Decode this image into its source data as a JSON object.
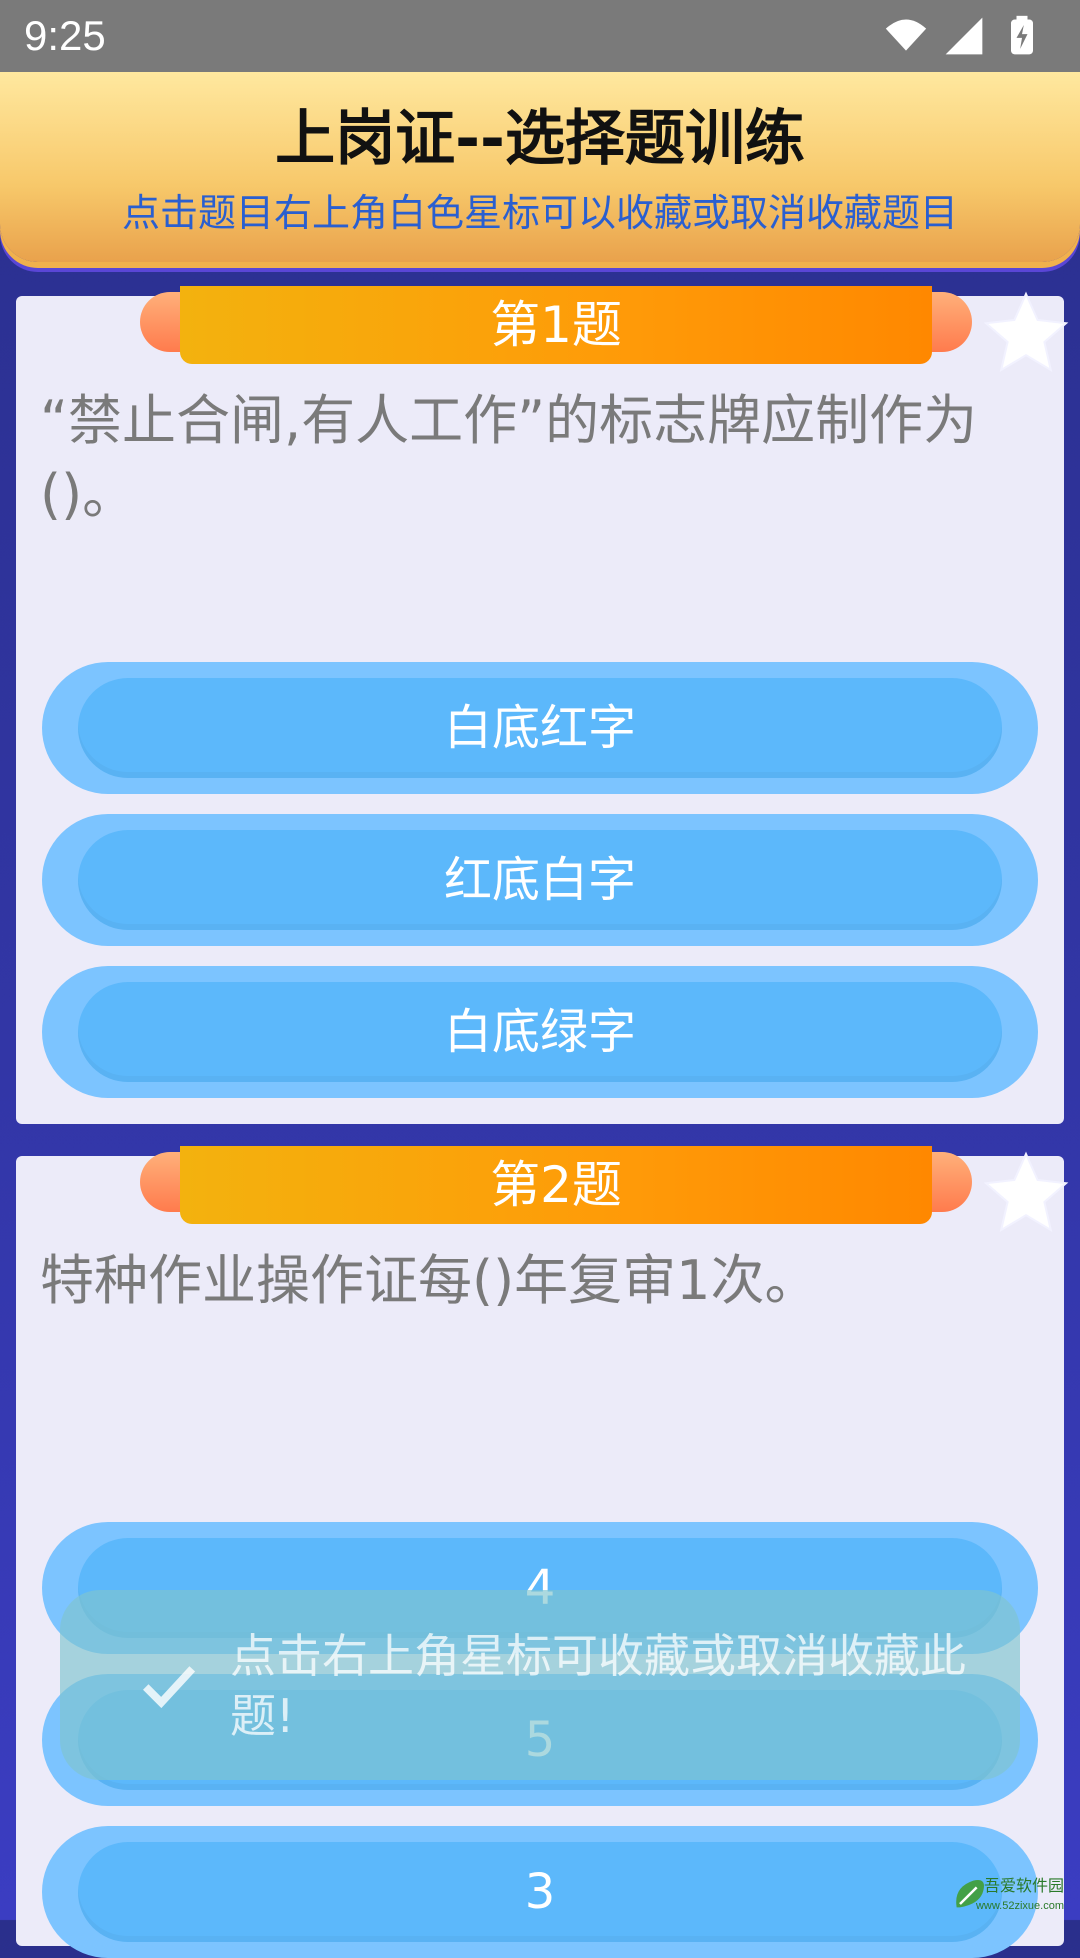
{
  "status_bar": {
    "time": "9:25",
    "icons": [
      "wifi-icon",
      "signal-icon",
      "battery-charging-icon"
    ]
  },
  "header": {
    "title": "上岗证--选择题训练",
    "subtitle": "点击题目右上角白色星标可以收藏或取消收藏题目"
  },
  "questions": [
    {
      "badge": "第1题",
      "text": "“禁止合闸,有人工作”的标志牌应制作为()。",
      "options": [
        "白底红字",
        "红底白字",
        "白底绿字"
      ]
    },
    {
      "badge": "第2题",
      "text": "特种作业操作证每()年复审1次。",
      "options": [
        "4",
        "5",
        "3"
      ]
    }
  ],
  "toast": {
    "text": "点击右上角星标可收藏或取消收藏此题!"
  },
  "watermark": {
    "text": "吾爱软件园",
    "url": "www.52zixue.com"
  },
  "colors": {
    "background": "#3236a6",
    "header_gold": "#f7c86a",
    "ribbon_orange": "#ff9a08",
    "option_blue": "#5cb8fb",
    "subtitle_blue": "#2a5fd0"
  }
}
